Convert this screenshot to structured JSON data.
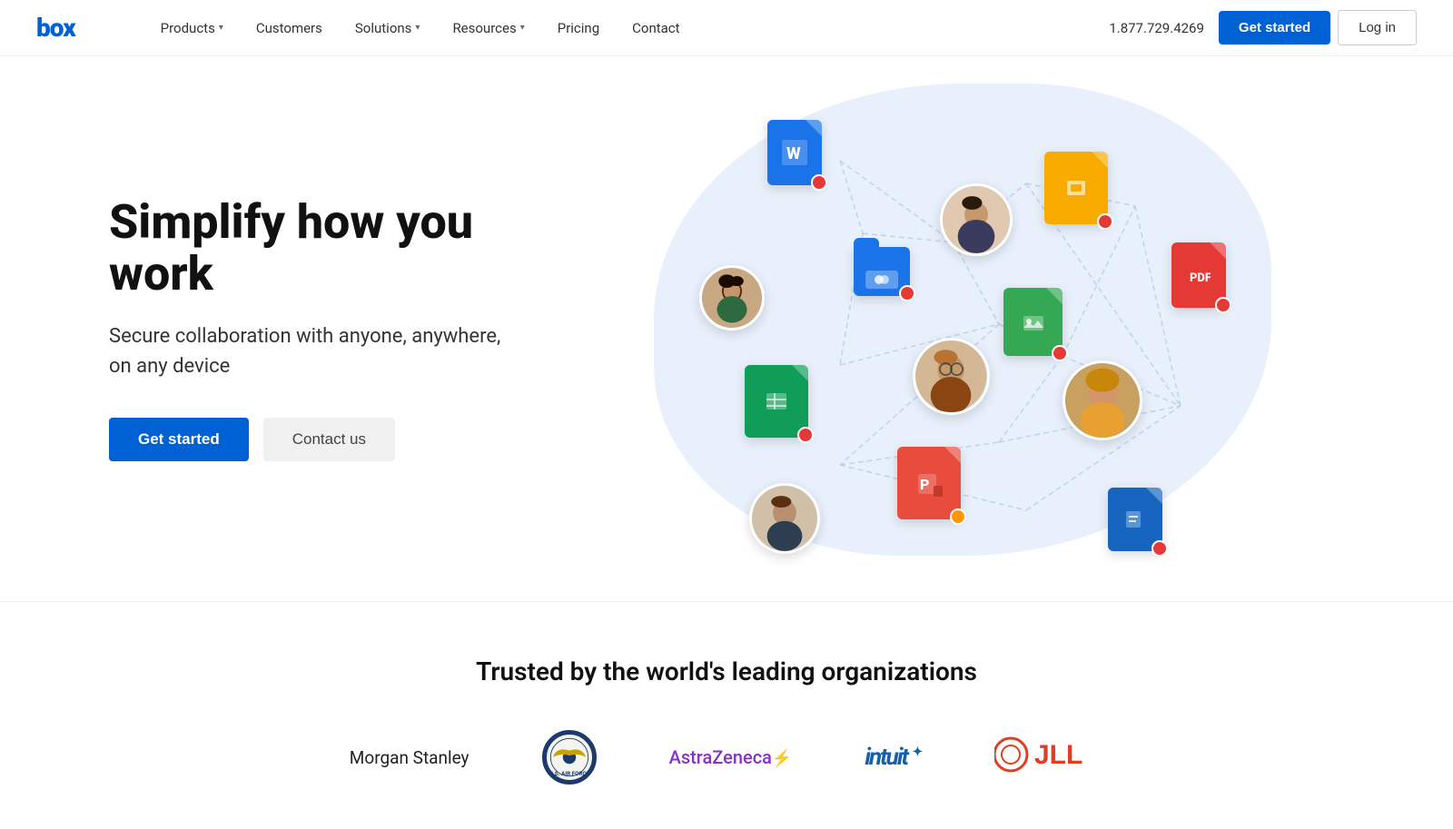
{
  "nav": {
    "logo": "box",
    "links": [
      {
        "label": "Products",
        "hasChevron": true
      },
      {
        "label": "Customers",
        "hasChevron": false
      },
      {
        "label": "Solutions",
        "hasChevron": true
      },
      {
        "label": "Resources",
        "hasChevron": true
      },
      {
        "label": "Pricing",
        "hasChevron": false
      },
      {
        "label": "Contact",
        "hasChevron": false
      }
    ],
    "phone": "1.877.729.4269",
    "get_started": "Get started",
    "login": "Log in"
  },
  "hero": {
    "title": "Simplify how you work",
    "subtitle": "Secure collaboration with anyone, anywhere, on any device",
    "cta_primary": "Get started",
    "cta_secondary": "Contact us"
  },
  "trusted": {
    "title": "Trusted by the world's leading organizations",
    "logos": [
      {
        "name": "Morgan Stanley",
        "type": "text"
      },
      {
        "name": "US Air Force",
        "type": "seal"
      },
      {
        "name": "AstraZeneca",
        "type": "text"
      },
      {
        "name": "Intuit",
        "type": "text"
      },
      {
        "name": "JLL",
        "type": "text"
      }
    ]
  }
}
